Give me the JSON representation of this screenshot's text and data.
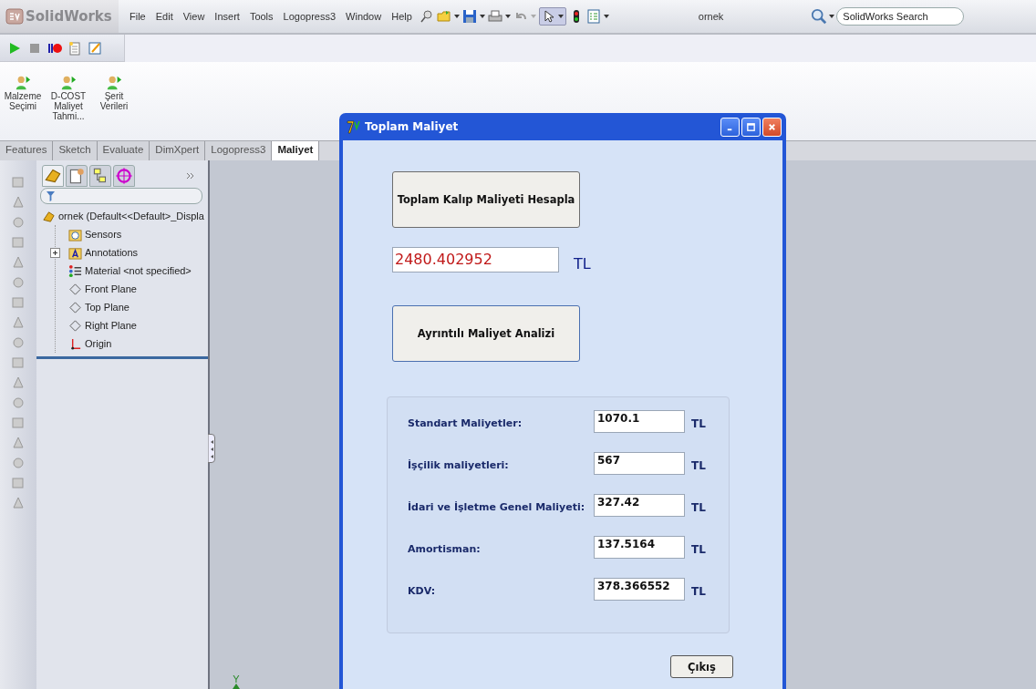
{
  "app": {
    "logo": "SolidWorks",
    "menus": [
      "File",
      "Edit",
      "View",
      "Insert",
      "Tools",
      "Logopress3",
      "Window",
      "Help"
    ],
    "document_title": "ornek",
    "search": {
      "placeholder": "SolidWorks Search"
    }
  },
  "command_buttons": [
    {
      "label": "Malzeme\nSeçimi"
    },
    {
      "label": "D-COST\nMaliyet\nTahmi..."
    },
    {
      "label": "Şerit\nVerileri"
    }
  ],
  "tabs": [
    {
      "label": "Features",
      "selected": false
    },
    {
      "label": "Sketch",
      "selected": false
    },
    {
      "label": "Evaluate",
      "selected": false
    },
    {
      "label": "DimXpert",
      "selected": false
    },
    {
      "label": "Logopress3",
      "selected": false
    },
    {
      "label": "Maliyet",
      "selected": true
    }
  ],
  "feature_tree": {
    "root": {
      "label": "ornek  (Default<<Default>_Displa",
      "children": [
        {
          "label": "Sensors",
          "kind": "sensors"
        },
        {
          "label": "Annotations",
          "kind": "annotations",
          "expanded": false
        },
        {
          "label": "Material <not specified>",
          "kind": "material"
        },
        {
          "label": "Front Plane",
          "kind": "plane"
        },
        {
          "label": "Top Plane",
          "kind": "plane"
        },
        {
          "label": "Right Plane",
          "kind": "plane"
        },
        {
          "label": "Origin",
          "kind": "origin"
        }
      ]
    }
  },
  "graphics": {
    "axis_label": "Y"
  },
  "dialog": {
    "title": "Toplam Maliyet",
    "calc_button": "Toplam Kalıp Maliyeti Hesapla",
    "total": {
      "value": "2480.402952",
      "unit": "TL"
    },
    "analysis_button": "Ayrıntılı Maliyet Analizi",
    "costs": [
      {
        "label": "Standart Maliyetler:",
        "value": "1070.1",
        "unit": "TL"
      },
      {
        "label": "İşçilik maliyetleri:",
        "value": "567",
        "unit": "TL"
      },
      {
        "label": "İdari ve İşletme Genel Maliyeti:",
        "value": "327.42",
        "unit": "TL"
      },
      {
        "label": "Amortisman:",
        "value": "137.5164",
        "unit": "TL"
      },
      {
        "label": "KDV:",
        "value": "378.366552",
        "unit": "TL"
      }
    ],
    "exit_button": "Çıkış"
  }
}
